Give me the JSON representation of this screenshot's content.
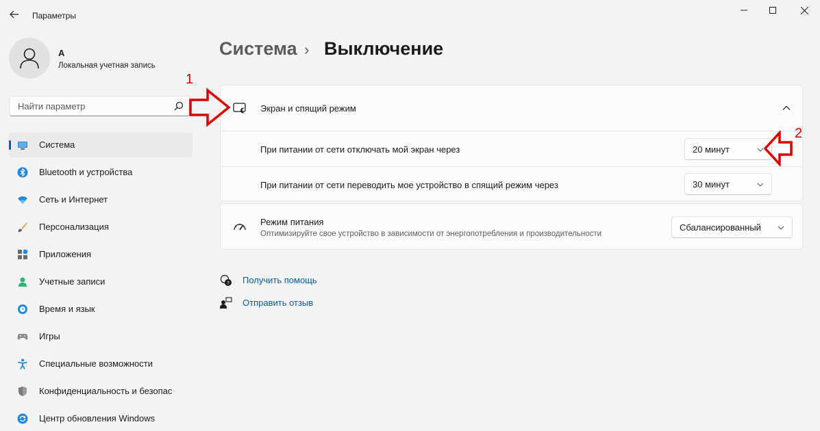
{
  "window": {
    "title": "Параметры"
  },
  "profile": {
    "name": "А",
    "account_type": "Локальная учетная запись"
  },
  "search": {
    "placeholder": "Найти параметр"
  },
  "sidebar": {
    "items": [
      {
        "label": "Система",
        "icon": "monitor-icon",
        "active": true
      },
      {
        "label": "Bluetooth и устройства",
        "icon": "bluetooth-icon"
      },
      {
        "label": "Сеть и Интернет",
        "icon": "wifi-icon"
      },
      {
        "label": "Персонализация",
        "icon": "brush-icon"
      },
      {
        "label": "Приложения",
        "icon": "apps-icon"
      },
      {
        "label": "Учетные записи",
        "icon": "person-icon"
      },
      {
        "label": "Время и язык",
        "icon": "globe-clock-icon"
      },
      {
        "label": "Игры",
        "icon": "gamepad-icon"
      },
      {
        "label": "Специальные возможности",
        "icon": "accessibility-icon"
      },
      {
        "label": "Конфиденциальность и безопас",
        "icon": "shield-icon"
      },
      {
        "label": "Центр обновления Windows",
        "icon": "update-icon"
      }
    ]
  },
  "breadcrumb": {
    "parent": "Система",
    "separator": "›",
    "current": "Выключение"
  },
  "screen_sleep": {
    "title": "Экран и спящий режим",
    "rows": [
      {
        "label": "При питании от сети отключать мой экран через",
        "value": "20 минут"
      },
      {
        "label": "При питании от сети переводить мое устройство в спящий режим через",
        "value": "30 минут"
      }
    ]
  },
  "power_mode": {
    "title": "Режим питания",
    "description": "Оптимизируйте свое устройство в зависимости от энергопотребления и производительности",
    "value": "Сбалансированный"
  },
  "links": {
    "help": "Получить помощь",
    "feedback": "Отправить отзыв"
  },
  "annotations": {
    "first": "1",
    "second": "2",
    "color": "#e00000"
  },
  "colors": {
    "accent": "#005fb8",
    "link": "#0959a8",
    "background": "#f3f3f3"
  }
}
